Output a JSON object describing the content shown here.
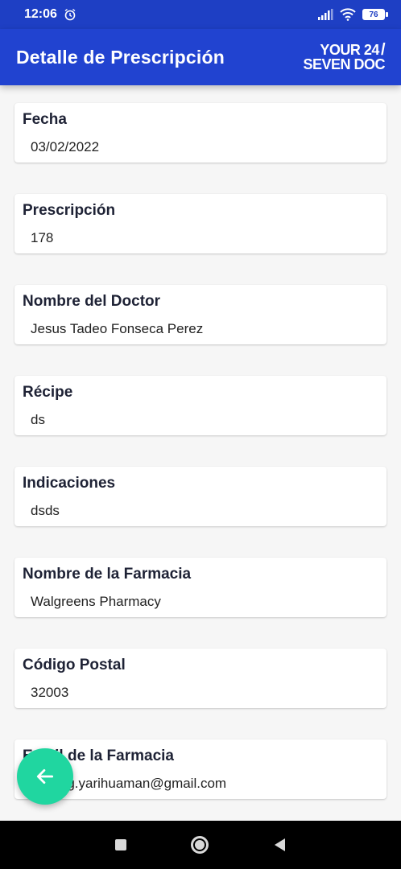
{
  "status": {
    "time": "12:06",
    "battery": "76"
  },
  "appbar": {
    "title": "Detalle de Prescripción",
    "brand_line1": "YOUR 24",
    "brand_line2": "SEVEN DOC"
  },
  "fields": [
    {
      "label": "Fecha",
      "value": "03/02/2022"
    },
    {
      "label": "Prescripción",
      "value": "178"
    },
    {
      "label": "Nombre del Doctor",
      "value": "Jesus Tadeo Fonseca Perez"
    },
    {
      "label": "Récipe",
      "value": "ds"
    },
    {
      "label": "Indicaciones",
      "value": "dsds"
    },
    {
      "label": "Nombre de la Farmacia",
      "value": "Walgreens Pharmacy"
    },
    {
      "label": "Código Postal",
      "value": "32003"
    },
    {
      "label": "Email de la Farmacia",
      "value": "sterling.yarihuaman@gmail.com"
    }
  ],
  "colors": {
    "primary": "#2143d0",
    "fab": "#20d6a0"
  },
  "icons": {
    "fab": "arrow-left-icon"
  }
}
